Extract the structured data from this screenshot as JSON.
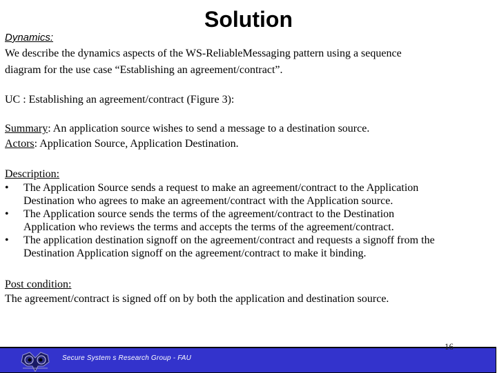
{
  "slide": {
    "title": "Solution",
    "dynamics_label": "Dynamics:",
    "dynamics_text_line1": "We describe the dynamics aspects of the WS-ReliableMessaging pattern using a  sequence",
    "dynamics_text_line2": "diagram for the use case “Establishing an agreement/contract”.",
    "uc_line": "UC : Establishing an agreement/contract (Figure 3):",
    "summary_label": "Summary",
    "summary_text": ": An application source wishes to send a message to a destination source.",
    "actors_label": "Actors",
    "actors_text": ": Application Source,  Application Destination.",
    "description_label": "Description:",
    "description_items": [
      {
        "bullet": "•",
        "line1": "The Application Source sends a request to make an agreement/contract to the Application",
        "line2": "Destination who agrees to make an agreement/contract with the Application source."
      },
      {
        "bullet": "•",
        "line1": "The Application source sends the terms of the agreement/contract to the Destination",
        "line2": "Application who reviews the terms and accepts the terms of the agreement/contract."
      },
      {
        "bullet": "•",
        "line1": "The application destination signoff on the agreement/contract and requests a signoff from the",
        "line2": "Destination Application signoff on the agreement/contract to make it binding."
      }
    ],
    "post_condition_label": "Post condition:",
    "post_condition_text": "The agreement/contract is signed off on by both the application and destination source."
  },
  "footer": {
    "text": "Secure System s Research Group - FAU",
    "logo_icon": "owl-logo-icon",
    "page_number": "16",
    "bar_color": "#3333cc"
  }
}
